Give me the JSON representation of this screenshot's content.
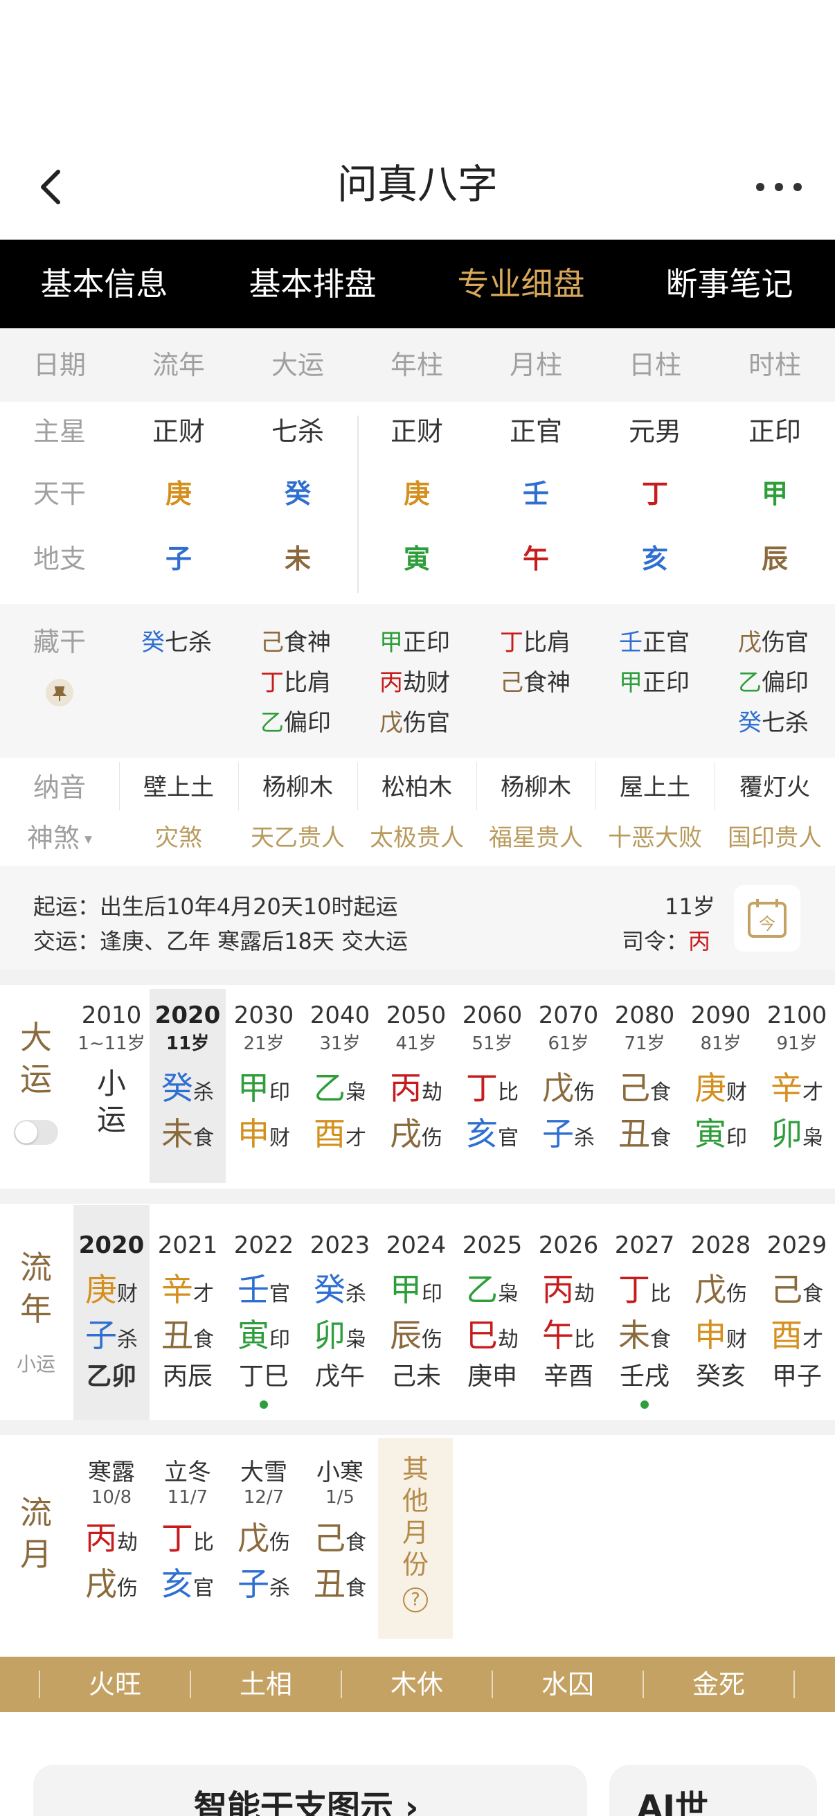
{
  "header": {
    "title": "问真八字"
  },
  "tabs": [
    "基本信息",
    "基本排盘",
    "专业细盘",
    "断事笔记"
  ],
  "columns": [
    "日期",
    "流年",
    "大运",
    "年柱",
    "月柱",
    "日柱",
    "时柱"
  ],
  "rows": {
    "zhuxing": {
      "label": "主星",
      "values": [
        "正财",
        "七杀",
        "正财",
        "正官",
        "元男",
        "正印"
      ]
    },
    "tiangan": {
      "label": "天干",
      "values": [
        "庚",
        "癸",
        "庚",
        "壬",
        "丁",
        "甲"
      ]
    },
    "dizhi": {
      "label": "地支",
      "values": [
        "子",
        "未",
        "寅",
        "午",
        "亥",
        "辰"
      ]
    }
  },
  "canggan": {
    "label": "藏干",
    "cols": [
      [
        {
          "g": "癸",
          "s": "七杀"
        }
      ],
      [
        {
          "g": "己",
          "s": "食神"
        },
        {
          "g": "丁",
          "s": "比肩"
        },
        {
          "g": "乙",
          "s": "偏印"
        }
      ],
      [
        {
          "g": "甲",
          "s": "正印"
        },
        {
          "g": "丙",
          "s": "劫财"
        },
        {
          "g": "戊",
          "s": "伤官"
        }
      ],
      [
        {
          "g": "丁",
          "s": "比肩"
        },
        {
          "g": "己",
          "s": "食神"
        }
      ],
      [
        {
          "g": "壬",
          "s": "正官"
        },
        {
          "g": "甲",
          "s": "正印"
        }
      ],
      [
        {
          "g": "戊",
          "s": "伤官"
        },
        {
          "g": "乙",
          "s": "偏印"
        },
        {
          "g": "癸",
          "s": "七杀"
        }
      ]
    ]
  },
  "nayin": {
    "label": "纳音",
    "values": [
      "壁上土",
      "杨柳木",
      "松柏木",
      "杨柳木",
      "屋上土",
      "覆灯火"
    ]
  },
  "shensha": {
    "label": "神煞",
    "values": [
      "灾煞",
      "天乙贵人",
      "太极贵人",
      "福星贵人",
      "十恶大败",
      "国印贵人"
    ]
  },
  "qiyun": {
    "line1": "起运：出生后10年4月20天10时起运",
    "line2": "交运：逢庚、乙年 寒露后18天 交大运",
    "age": "11岁",
    "siling_label": "司令：",
    "siling_value": "丙"
  },
  "dayun": {
    "label": [
      "大",
      "运"
    ],
    "cols": [
      {
        "year": "2010",
        "age": "1~11岁",
        "xiao": [
          "小",
          "运"
        ]
      },
      {
        "year": "2020",
        "age": "11岁",
        "g": "癸",
        "gs": "杀",
        "z": "未",
        "zs": "食"
      },
      {
        "year": "2030",
        "age": "21岁",
        "g": "甲",
        "gs": "印",
        "z": "申",
        "zs": "财"
      },
      {
        "year": "2040",
        "age": "31岁",
        "g": "乙",
        "gs": "枭",
        "z": "酉",
        "zs": "才"
      },
      {
        "year": "2050",
        "age": "41岁",
        "g": "丙",
        "gs": "劫",
        "z": "戌",
        "zs": "伤"
      },
      {
        "year": "2060",
        "age": "51岁",
        "g": "丁",
        "gs": "比",
        "z": "亥",
        "zs": "官"
      },
      {
        "year": "2070",
        "age": "61岁",
        "g": "戊",
        "gs": "伤",
        "z": "子",
        "zs": "杀"
      },
      {
        "year": "2080",
        "age": "71岁",
        "g": "己",
        "gs": "食",
        "z": "丑",
        "zs": "食"
      },
      {
        "year": "2090",
        "age": "81岁",
        "g": "庚",
        "gs": "财",
        "z": "寅",
        "zs": "印"
      },
      {
        "year": "2100",
        "age": "91岁",
        "g": "辛",
        "gs": "才",
        "z": "卯",
        "zs": "枭"
      }
    ]
  },
  "liunian": {
    "label": [
      "流",
      "年"
    ],
    "sublabel": "小运",
    "cols": [
      {
        "year": "2020",
        "g": "庚",
        "gs": "财",
        "z": "子",
        "zs": "杀",
        "x": "乙卯"
      },
      {
        "year": "2021",
        "g": "辛",
        "gs": "才",
        "z": "丑",
        "zs": "食",
        "x": "丙辰"
      },
      {
        "year": "2022",
        "g": "壬",
        "gs": "官",
        "z": "寅",
        "zs": "印",
        "x": "丁巳"
      },
      {
        "year": "2023",
        "g": "癸",
        "gs": "杀",
        "z": "卯",
        "zs": "枭",
        "x": "戊午"
      },
      {
        "year": "2024",
        "g": "甲",
        "gs": "印",
        "z": "辰",
        "zs": "伤",
        "x": "己未"
      },
      {
        "year": "2025",
        "g": "乙",
        "gs": "枭",
        "z": "巳",
        "zs": "劫",
        "x": "庚申"
      },
      {
        "year": "2026",
        "g": "丙",
        "gs": "劫",
        "z": "午",
        "zs": "比",
        "x": "辛酉"
      },
      {
        "year": "2027",
        "g": "丁",
        "gs": "比",
        "z": "未",
        "zs": "食",
        "x": "壬戌"
      },
      {
        "year": "2028",
        "g": "戊",
        "gs": "伤",
        "z": "申",
        "zs": "财",
        "x": "癸亥"
      },
      {
        "year": "2029",
        "g": "己",
        "gs": "食",
        "z": "酉",
        "zs": "才",
        "x": "甲子"
      }
    ]
  },
  "liuyue": {
    "label": [
      "流",
      "月"
    ],
    "cols": [
      {
        "term": "寒露",
        "date": "10/8",
        "g": "丙",
        "gs": "劫",
        "z": "戌",
        "zs": "伤"
      },
      {
        "term": "立冬",
        "date": "11/7",
        "g": "丁",
        "gs": "比",
        "z": "亥",
        "zs": "官"
      },
      {
        "term": "大雪",
        "date": "12/7",
        "g": "戊",
        "gs": "伤",
        "z": "子",
        "zs": "杀"
      },
      {
        "term": "小寒",
        "date": "1/5",
        "g": "己",
        "gs": "食",
        "z": "丑",
        "zs": "食"
      }
    ],
    "other": [
      "其",
      "他",
      "月",
      "份"
    ],
    "other_icon": "?"
  },
  "elements": [
    "火旺",
    "土相",
    "木休",
    "水囚",
    "金死"
  ],
  "bottom": {
    "left_text": "智能干支图示 ›",
    "right_text": "AI世"
  },
  "colors": {
    "metal": "#d4901f",
    "water": "#2f6fd1",
    "wood": "#2e9e3a",
    "fire": "#c61c1c",
    "earth": "#8a6a3c",
    "tab_active": "#d7a85b",
    "element_bar": "#c4a263"
  }
}
